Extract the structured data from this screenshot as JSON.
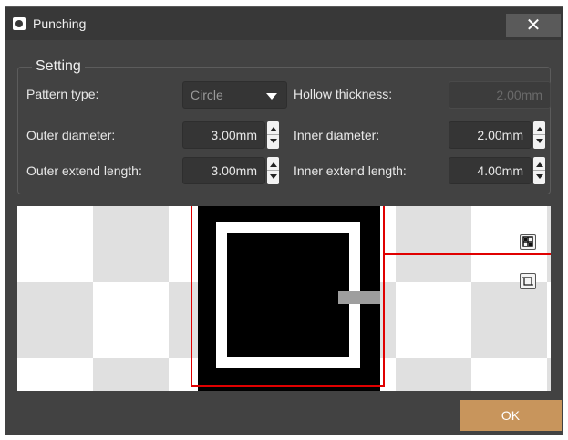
{
  "window": {
    "title": "Punching",
    "close_label": "✕",
    "icon": "punching-app-icon"
  },
  "setting": {
    "group_title": "Setting",
    "pattern_type": {
      "label": "Pattern type:",
      "value": "Circle"
    },
    "hollow_thickness": {
      "label": "Hollow thickness:",
      "value": "2.00mm"
    },
    "outer_diameter": {
      "label": "Outer diameter:",
      "value": "3.00mm"
    },
    "inner_diameter": {
      "label": "Inner diameter:",
      "value": "2.00mm"
    },
    "outer_extend_length": {
      "label": "Outer extend length:",
      "value": "3.00mm"
    },
    "inner_extend_length": {
      "label": "Inner extend length:",
      "value": "4.00mm"
    }
  },
  "preview": {
    "tools": [
      {
        "icon": "fit-view-icon"
      },
      {
        "icon": "frame-icon"
      }
    ]
  },
  "footer": {
    "ok_label": "OK"
  },
  "colors": {
    "accent": "#c8955c",
    "selection": "#e00000",
    "background": "#424242"
  }
}
